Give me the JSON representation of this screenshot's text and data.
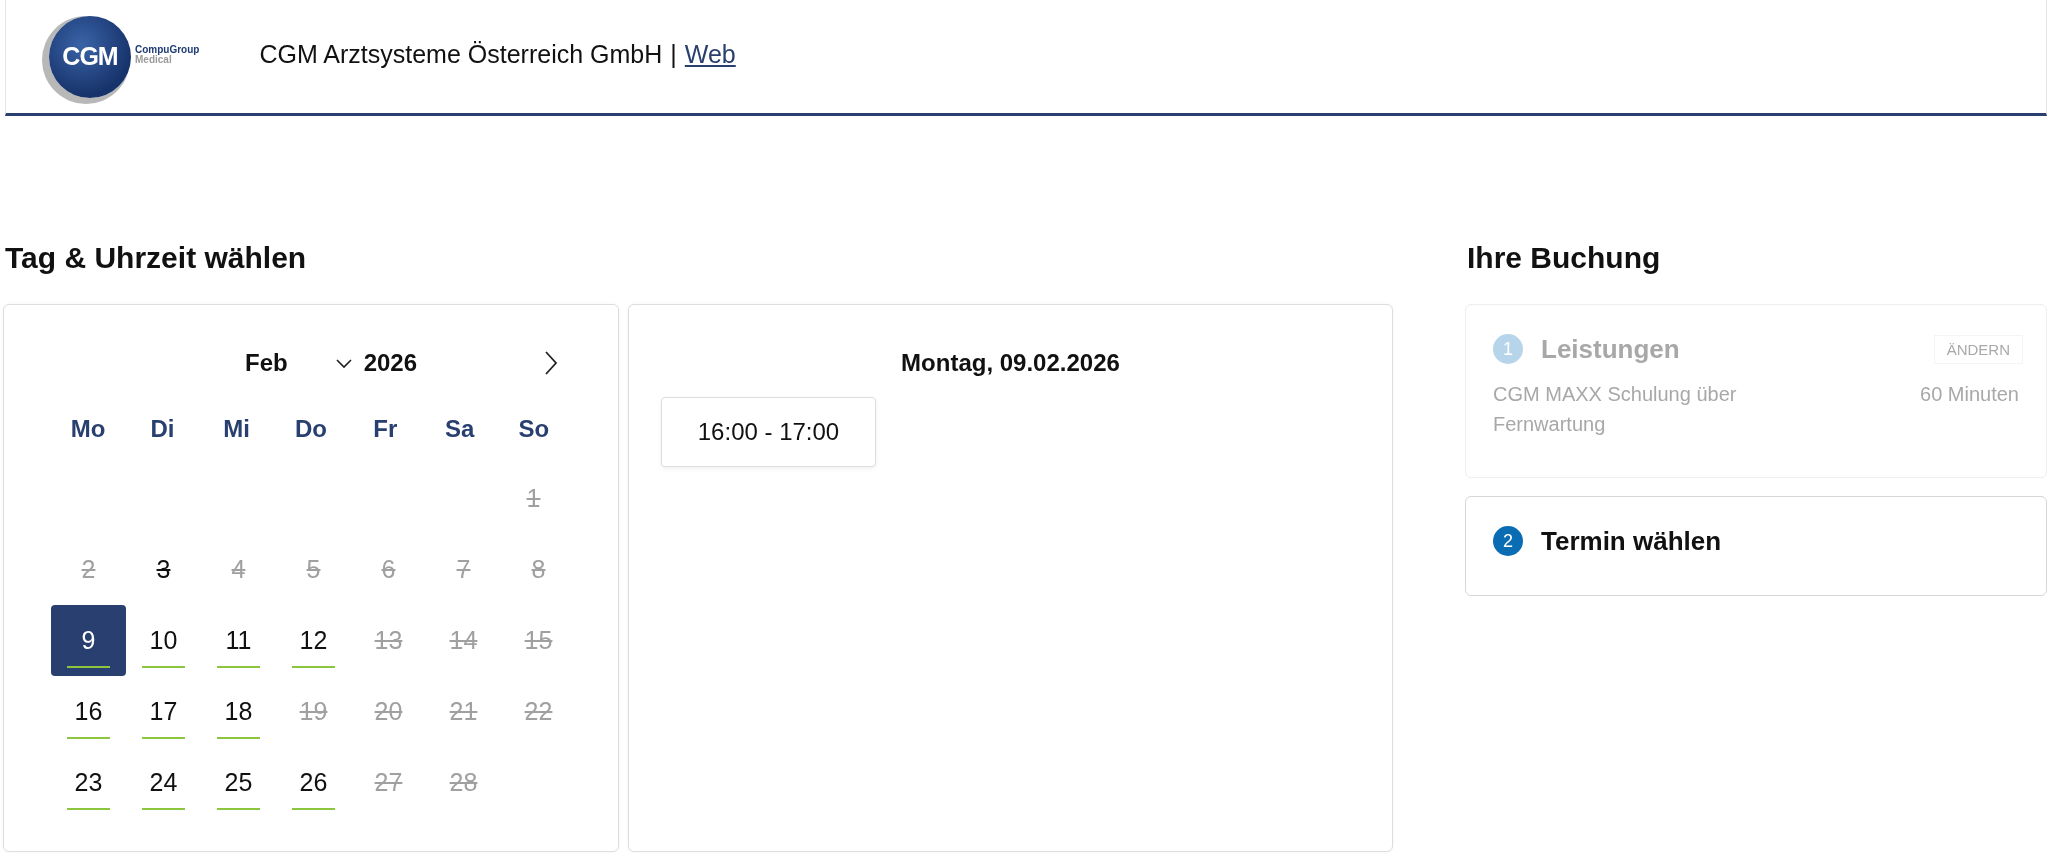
{
  "header": {
    "logo": {
      "initials": "CGM",
      "line1": "CompuGroup",
      "line2": "Medical"
    },
    "company": "CGM Arztsysteme Österreich GmbH",
    "separator": "|",
    "link": "Web"
  },
  "schedule": {
    "title": "Tag & Uhrzeit wählen",
    "calendar": {
      "month": "Feb",
      "year": "2026",
      "weekdays": [
        "Mo",
        "Di",
        "Mi",
        "Do",
        "Fr",
        "Sa",
        "So"
      ],
      "weeks": [
        {
          "days": [
            {
              "kind": "blank"
            },
            {
              "kind": "blank"
            },
            {
              "kind": "blank"
            },
            {
              "kind": "blank"
            },
            {
              "kind": "blank"
            },
            {
              "kind": "blank"
            },
            {
              "kind": "day",
              "label": "1",
              "available": false,
              "today": false,
              "selected": false
            }
          ]
        },
        {
          "days": [
            {
              "label": "2",
              "available": false,
              "today": false,
              "selected": false
            },
            {
              "label": "3",
              "available": false,
              "today": true,
              "selected": false
            },
            {
              "label": "4",
              "available": false,
              "today": false,
              "selected": false
            },
            {
              "label": "5",
              "available": false,
              "today": false,
              "selected": false
            },
            {
              "label": "6",
              "available": false,
              "today": false,
              "selected": false
            },
            {
              "label": "7",
              "available": false,
              "today": false,
              "selected": false
            },
            {
              "label": "8",
              "available": false,
              "today": false,
              "selected": false
            }
          ]
        },
        {
          "days": [
            {
              "label": "9",
              "available": true,
              "today": false,
              "selected": true
            },
            {
              "label": "10",
              "available": true,
              "today": false,
              "selected": false
            },
            {
              "label": "11",
              "available": true,
              "today": false,
              "selected": false
            },
            {
              "label": "12",
              "available": true,
              "today": false,
              "selected": false
            },
            {
              "label": "13",
              "available": false,
              "today": false,
              "selected": false
            },
            {
              "label": "14",
              "available": false,
              "today": false,
              "selected": false
            },
            {
              "label": "15",
              "available": false,
              "today": false,
              "selected": false
            }
          ]
        },
        {
          "days": [
            {
              "label": "16",
              "available": true,
              "today": false,
              "selected": false
            },
            {
              "label": "17",
              "available": true,
              "today": false,
              "selected": false
            },
            {
              "label": "18",
              "available": true,
              "today": false,
              "selected": false
            },
            {
              "label": "19",
              "available": false,
              "today": false,
              "selected": false
            },
            {
              "label": "20",
              "available": false,
              "today": false,
              "selected": false
            },
            {
              "label": "21",
              "available": false,
              "today": false,
              "selected": false
            },
            {
              "label": "22",
              "available": false,
              "today": false,
              "selected": false
            }
          ]
        },
        {
          "days": [
            {
              "label": "23",
              "available": true,
              "today": false,
              "selected": false
            },
            {
              "label": "24",
              "available": true,
              "today": false,
              "selected": false
            },
            {
              "label": "25",
              "available": true,
              "today": false,
              "selected": false
            },
            {
              "label": "26",
              "available": true,
              "today": false,
              "selected": false
            },
            {
              "label": "27",
              "available": false,
              "today": false,
              "selected": false
            },
            {
              "label": "28",
              "available": false,
              "today": false,
              "selected": false
            }
          ]
        }
      ]
    },
    "day_title": "Montag, 09.02.2026",
    "slots": [
      "16:00 - 17:00"
    ]
  },
  "booking": {
    "title": "Ihre Buchung",
    "steps": [
      {
        "number": "1",
        "title": "Leistungen",
        "active": false,
        "action": "ÄNDERN",
        "service": "CGM MAXX Schulung über Fernwartung",
        "duration": "60 Minuten"
      },
      {
        "number": "2",
        "title": "Termin wählen",
        "active": true
      }
    ]
  }
}
